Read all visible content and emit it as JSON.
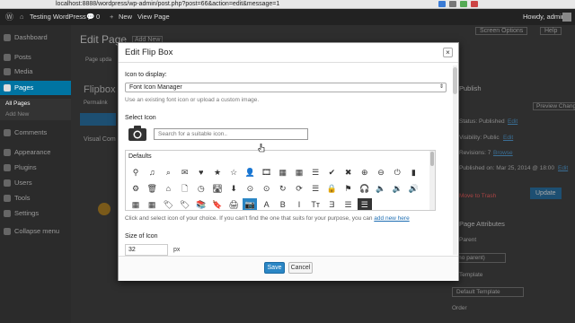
{
  "browser": {
    "url": "localhost:8888/wordpress/wp-admin/post.php?post=66&action=edit&message=1"
  },
  "admin_bar": {
    "site_name": "Testing WordPress",
    "comments_count": "0",
    "new_label": "New",
    "view_page_label": "View Page",
    "howdy": "Howdy, admin"
  },
  "sidebar": {
    "items": [
      {
        "label": "Dashboard",
        "icon": "dashboard-icon"
      },
      {
        "label": "Posts",
        "icon": "pin-icon"
      },
      {
        "label": "Media",
        "icon": "media-icon"
      },
      {
        "label": "Pages",
        "icon": "pages-icon"
      },
      {
        "label": "Comments",
        "icon": "comment-icon"
      },
      {
        "label": "Appearance",
        "icon": "brush-icon"
      },
      {
        "label": "Plugins",
        "icon": "plug-icon"
      },
      {
        "label": "Users",
        "icon": "user-icon"
      },
      {
        "label": "Tools",
        "icon": "wrench-icon"
      },
      {
        "label": "Settings",
        "icon": "settings-icon"
      },
      {
        "label": "Collapse menu",
        "icon": "collapse-icon"
      }
    ],
    "subitems": [
      "All Pages",
      "Add New"
    ]
  },
  "background": {
    "page_title": "Edit Page",
    "add_new": "Add New",
    "screen_options": "Screen Options",
    "help": "Help",
    "notice": "Page upda",
    "post_title": "Flipbox",
    "permalink": "Permalink",
    "visual_composer": "Visual Com",
    "publish": "Publish",
    "preview_changes": "Preview Changes",
    "status": "Status: Published",
    "status_edit": "Edit",
    "visibility": "Visibility: Public",
    "visibility_edit": "Edit",
    "revisions": "Revisions: 7",
    "revisions_browse": "Browse",
    "published_on": "Published on: Mar 25, 2014 @ 18:00",
    "published_edit": "Edit",
    "move_to_trash": "Move to Trash",
    "update": "Update",
    "page_attributes": "Page Attributes",
    "parent": "Parent",
    "no_parent": "(no parent)",
    "template": "Template",
    "default_template": "Default Template",
    "order": "Order"
  },
  "modal": {
    "title": "Edit Flip Box",
    "close_label": "×",
    "icon_to_display_label": "Icon to display:",
    "icon_select_value": "Font Icon Manager",
    "icon_hint": "Use an existing font icon or upload a custom image.",
    "select_icon_label": "Select Icon",
    "search_placeholder": "Search for a suitable icon..",
    "defaults_label": "Defaults",
    "icon_rows": [
      [
        "⚲",
        "♫",
        "⌕",
        "✉",
        "♥",
        "★",
        "☆",
        "👤",
        "🎞",
        "▦",
        "▦",
        "☰",
        "✔",
        "✖",
        "⊕",
        "⊖",
        "⏻",
        "▮"
      ],
      [
        "⚙",
        "🗑",
        "⌂",
        "🗋",
        "◷",
        "🛣",
        "⬇",
        "⊙",
        "⊙",
        "↻",
        "⟳",
        "☰",
        "🔒",
        "⚑",
        "🎧",
        "🔈",
        "🔉",
        "🔊"
      ],
      [
        "▦",
        "▦",
        "🏷",
        "🏷",
        "📚",
        "🔖",
        "🖨",
        "📷",
        "A",
        "B",
        "I",
        "Tт",
        "Ǝ",
        "☰",
        "☰"
      ]
    ],
    "selected_icon_index": [
      2,
      7
    ],
    "dark_icon_index": [
      2,
      14
    ],
    "icon_note_text": "Click and select icon of your choice. If you can't find the one that suits for your purpose, you can",
    "icon_note_link": "add new here",
    "size_label": "Size of Icon",
    "size_value": "32",
    "size_unit": "px",
    "save_label": "Save",
    "cancel_label": "Cancel"
  },
  "colors": {
    "accent": "#2a86c5",
    "admin_bar": "#222222",
    "sidebar_active": "#0074a2"
  }
}
